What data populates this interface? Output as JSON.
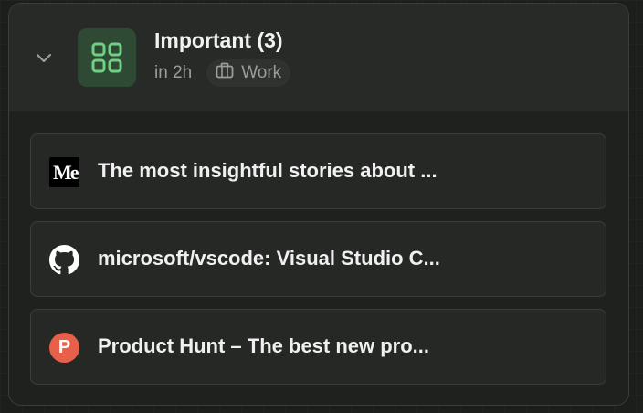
{
  "group": {
    "title": "Important (3)",
    "time": "in 2h",
    "tag_label": "Work",
    "icon": "grid-icon",
    "accent": "#6fcf82"
  },
  "items": [
    {
      "title": "The most insightful stories about ...",
      "favicon": "medium-logo",
      "favicon_text": "Me"
    },
    {
      "title": "microsoft/vscode: Visual Studio C...",
      "favicon": "github-logo"
    },
    {
      "title": "Product Hunt – The best new pro...",
      "favicon": "producthunt-logo",
      "favicon_text": "P",
      "favicon_color": "#e8604a"
    }
  ]
}
